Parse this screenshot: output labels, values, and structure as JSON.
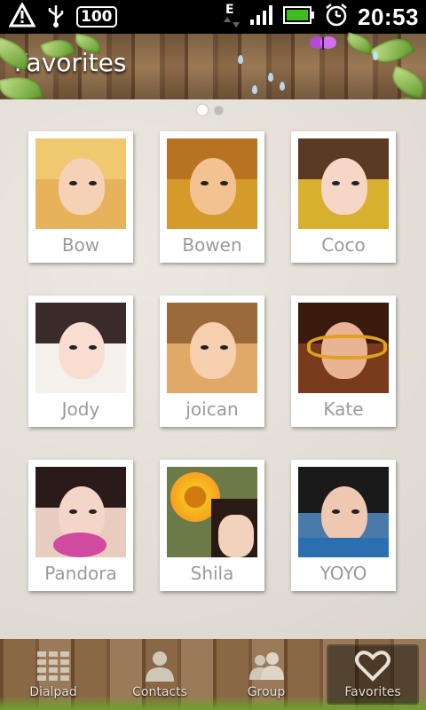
{
  "status_bar": {
    "battery_level_label": "100",
    "network_type": "E",
    "time": "20:53",
    "icons": [
      "warning-icon",
      "usb-icon",
      "battery-100-icon",
      "network-e-icon",
      "signal-icon",
      "battery-icon",
      "alarm-icon"
    ]
  },
  "header": {
    "title": "Favorites"
  },
  "pager": {
    "pages": 2,
    "current": 1
  },
  "favorites": [
    {
      "name": "Bow"
    },
    {
      "name": "Bowen"
    },
    {
      "name": "Coco"
    },
    {
      "name": "Jody"
    },
    {
      "name": "joican"
    },
    {
      "name": "Kate"
    },
    {
      "name": "Pandora"
    },
    {
      "name": "Shila"
    },
    {
      "name": "YOYO"
    }
  ],
  "tabs": [
    {
      "label": "Dialpad",
      "icon": "dialpad-icon",
      "active": false
    },
    {
      "label": "Contacts",
      "icon": "person-icon",
      "active": false
    },
    {
      "label": "Group",
      "icon": "group-icon",
      "active": false
    },
    {
      "label": "Favorites",
      "icon": "heart-icon",
      "active": true
    }
  ],
  "colors": {
    "status_bar_bg": "#000000",
    "name_text": "#9a9a9a",
    "battery_green": "#3dbb1f"
  }
}
